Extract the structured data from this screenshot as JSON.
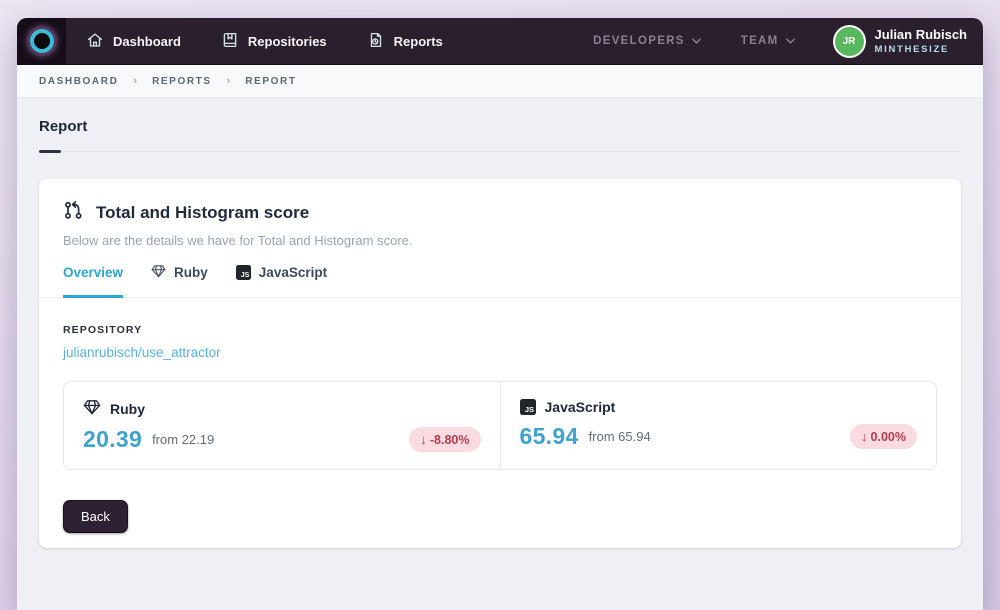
{
  "navbar": {
    "items": [
      {
        "icon": "home-icon",
        "label": "Dashboard"
      },
      {
        "icon": "book-icon",
        "label": "Repositories"
      },
      {
        "icon": "document-clock-icon",
        "label": "Reports"
      }
    ],
    "menus": [
      {
        "label": "DEVELOPERS"
      },
      {
        "label": "TEAM"
      }
    ],
    "user": {
      "initials": "JR",
      "name": "Julian Rubisch",
      "org": "MINTHESIZE"
    }
  },
  "breadcrumb": {
    "items": [
      "DASHBOARD",
      "REPORTS",
      "REPORT"
    ],
    "separator": "›"
  },
  "page": {
    "title": "Report"
  },
  "report_card": {
    "title": "Total and Histogram score",
    "subtitle": "Below are the details we have for Total and Histogram score.",
    "tabs": [
      {
        "label": "Overview",
        "active": true
      },
      {
        "label": "Ruby",
        "icon": "gem-icon"
      },
      {
        "label": "JavaScript",
        "icon": "js-icon"
      }
    ],
    "repository": {
      "label": "REPOSITORY",
      "link": "julianrubisch/use_attractor"
    },
    "stats": [
      {
        "icon": "gem-icon",
        "name": "Ruby",
        "value": "20.39",
        "from_label": "from 22.19",
        "arrow": "↓",
        "change": "-8.80%",
        "direction": "down"
      },
      {
        "icon": "js-icon",
        "name": "JavaScript",
        "value": "65.94",
        "from_label": "from 65.94",
        "arrow": "↓",
        "change": "0.00%",
        "direction": "down"
      }
    ],
    "back_label": "Back",
    "js_glyph": "JS"
  },
  "colors": {
    "navbar_bg": "#2a1f2d",
    "logo_block_bg": "#150d17",
    "accent_blue": "#2da6d5",
    "value_blue": "#3fa2cd",
    "link_blue": "#58b3d9",
    "badge_bg": "#fadbe0",
    "badge_text": "#b43e50",
    "avatar_green": "#57b85e",
    "page_bg": "#e4daee",
    "content_bg": "#eef0f5"
  }
}
